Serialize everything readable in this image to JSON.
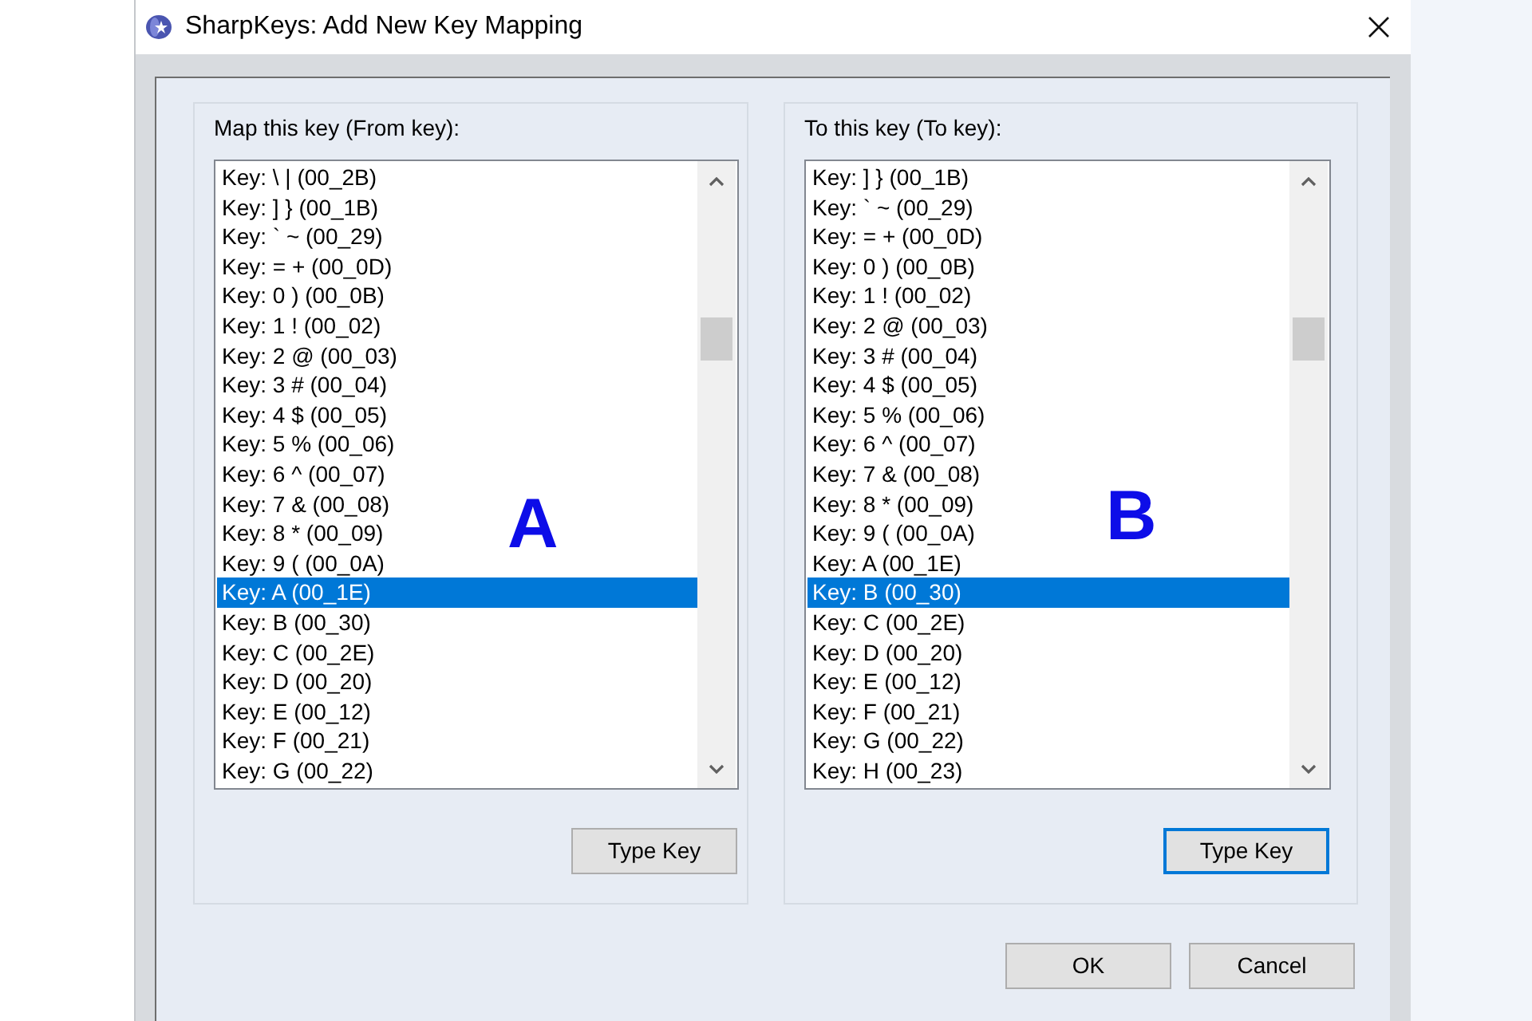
{
  "window": {
    "title": "SharpKeys: Add New Key Mapping"
  },
  "panels": [
    {
      "label": "Map this key (From key):",
      "annotation": "A",
      "items": [
        {
          "text": "Key: \\ | (00_2B)",
          "selected": false
        },
        {
          "text": "Key: ] } (00_1B)",
          "selected": false
        },
        {
          "text": "Key: ` ~ (00_29)",
          "selected": false
        },
        {
          "text": "Key: = + (00_0D)",
          "selected": false
        },
        {
          "text": "Key: 0 ) (00_0B)",
          "selected": false
        },
        {
          "text": "Key: 1 ! (00_02)",
          "selected": false
        },
        {
          "text": "Key: 2 @ (00_03)",
          "selected": false
        },
        {
          "text": "Key: 3 # (00_04)",
          "selected": false
        },
        {
          "text": "Key: 4 $ (00_05)",
          "selected": false
        },
        {
          "text": "Key: 5 % (00_06)",
          "selected": false
        },
        {
          "text": "Key: 6 ^ (00_07)",
          "selected": false
        },
        {
          "text": "Key: 7 & (00_08)",
          "selected": false
        },
        {
          "text": "Key: 8 * (00_09)",
          "selected": false
        },
        {
          "text": "Key: 9 ( (00_0A)",
          "selected": false
        },
        {
          "text": "Key: A (00_1E)",
          "selected": true
        },
        {
          "text": "Key: B (00_30)",
          "selected": false
        },
        {
          "text": "Key: C (00_2E)",
          "selected": false
        },
        {
          "text": "Key: D (00_20)",
          "selected": false
        },
        {
          "text": "Key: E (00_12)",
          "selected": false
        },
        {
          "text": "Key: F (00_21)",
          "selected": false
        },
        {
          "text": "Key: G (00_22)",
          "selected": false
        }
      ],
      "button": {
        "label": "Type Key",
        "focused": false
      }
    },
    {
      "label": "To this key (To key):",
      "annotation": "B",
      "items": [
        {
          "text": "Key: ] } (00_1B)",
          "selected": false
        },
        {
          "text": "Key: ` ~ (00_29)",
          "selected": false
        },
        {
          "text": "Key: = + (00_0D)",
          "selected": false
        },
        {
          "text": "Key: 0 ) (00_0B)",
          "selected": false
        },
        {
          "text": "Key: 1 ! (00_02)",
          "selected": false
        },
        {
          "text": "Key: 2 @ (00_03)",
          "selected": false
        },
        {
          "text": "Key: 3 # (00_04)",
          "selected": false
        },
        {
          "text": "Key: 4 $ (00_05)",
          "selected": false
        },
        {
          "text": "Key: 5 % (00_06)",
          "selected": false
        },
        {
          "text": "Key: 6 ^ (00_07)",
          "selected": false
        },
        {
          "text": "Key: 7 & (00_08)",
          "selected": false
        },
        {
          "text": "Key: 8 * (00_09)",
          "selected": false
        },
        {
          "text": "Key: 9 ( (00_0A)",
          "selected": false
        },
        {
          "text": "Key: A (00_1E)",
          "selected": false
        },
        {
          "text": "Key: B (00_30)",
          "selected": true
        },
        {
          "text": "Key: C (00_2E)",
          "selected": false
        },
        {
          "text": "Key: D (00_20)",
          "selected": false
        },
        {
          "text": "Key: E (00_12)",
          "selected": false
        },
        {
          "text": "Key: F (00_21)",
          "selected": false
        },
        {
          "text": "Key: G (00_22)",
          "selected": false
        },
        {
          "text": "Key: H (00_23)",
          "selected": false
        }
      ],
      "button": {
        "label": "Type Key",
        "focused": true
      }
    }
  ],
  "buttons": [
    {
      "label": "OK"
    },
    {
      "label": "Cancel"
    }
  ]
}
